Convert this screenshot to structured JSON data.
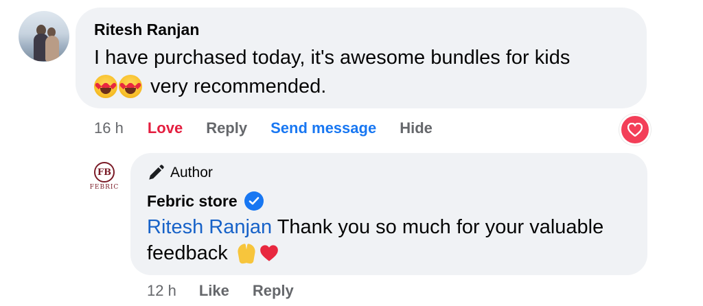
{
  "comment": {
    "author": "Ritesh Ranjan",
    "text_line1": "I have purchased today, it's awesome bundles for kids",
    "text_line2": "very recommended.",
    "time": "16 h",
    "actions": {
      "love": "Love",
      "reply": "Reply",
      "send_message": "Send message",
      "hide": "Hide"
    },
    "reaction_icon": "love-reaction-icon",
    "colors": {
      "love": "#e41e3f",
      "send_message": "#1877f2",
      "bubble": "#f0f2f5",
      "meta": "#65676b"
    }
  },
  "reply": {
    "badge": "Author",
    "author": "Febric store",
    "logo_text": "FEBRIC",
    "logo_initials": "FB",
    "mention": "Ritesh Ranjan",
    "text_line1": " Thank you so much for your valuable",
    "text_line2": "feedback",
    "time": "12 h",
    "actions": {
      "like": "Like",
      "reply": "Reply"
    },
    "colors": {
      "mention": "#1762c8",
      "verified": "#1877f2"
    }
  }
}
